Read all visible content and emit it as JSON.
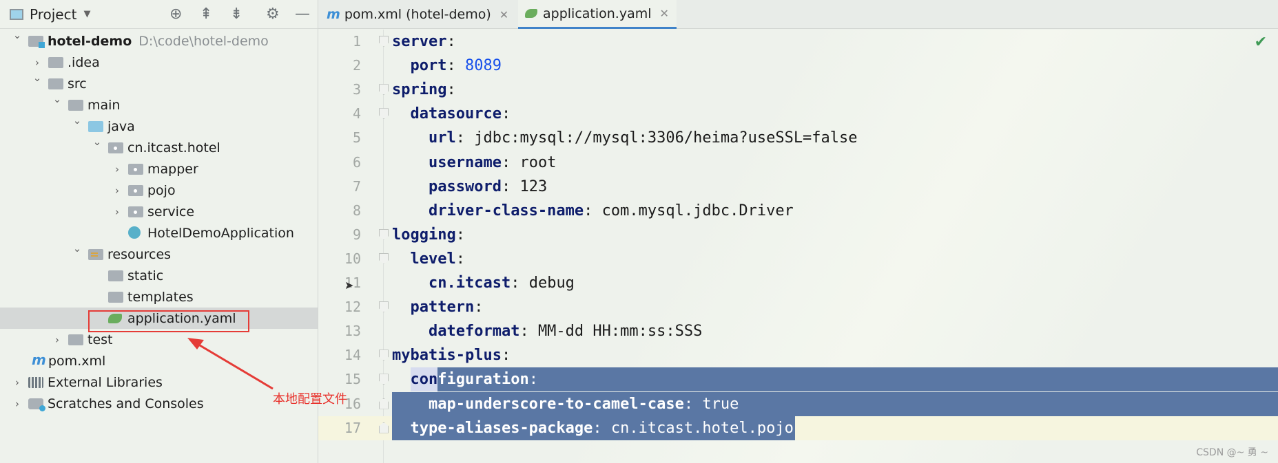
{
  "sidebar": {
    "title": "Project",
    "toolbar": [
      "locate-icon",
      "expand-all-icon",
      "collapse-all-icon",
      "gear-icon",
      "minimize-icon"
    ],
    "items": [
      {
        "label": "hotel-demo",
        "extra": "D:\\code\\hotel-demo",
        "depth": 0,
        "arrow": "open",
        "icon": "mod",
        "bold": true
      },
      {
        "label": ".idea",
        "depth": 1,
        "arrow": "closed",
        "icon": "fold"
      },
      {
        "label": "src",
        "depth": 1,
        "arrow": "open",
        "icon": "fold"
      },
      {
        "label": "main",
        "depth": 2,
        "arrow": "open",
        "icon": "fold"
      },
      {
        "label": "java",
        "depth": 3,
        "arrow": "open",
        "icon": "fold-blue"
      },
      {
        "label": "cn.itcast.hotel",
        "depth": 4,
        "arrow": "open",
        "icon": "pkg"
      },
      {
        "label": "mapper",
        "depth": 5,
        "arrow": "closed",
        "icon": "pkg"
      },
      {
        "label": "pojo",
        "depth": 5,
        "arrow": "closed",
        "icon": "pkg"
      },
      {
        "label": "service",
        "depth": 5,
        "arrow": "closed",
        "icon": "pkg"
      },
      {
        "label": "HotelDemoApplication",
        "depth": 5,
        "arrow": "none",
        "icon": "spr"
      },
      {
        "label": "resources",
        "depth": 3,
        "arrow": "open",
        "icon": "res"
      },
      {
        "label": "static",
        "depth": 4,
        "arrow": "none",
        "icon": "fold"
      },
      {
        "label": "templates",
        "depth": 4,
        "arrow": "none",
        "icon": "fold"
      },
      {
        "label": "application.yaml",
        "depth": 4,
        "arrow": "none",
        "icon": "yml",
        "selected": true
      },
      {
        "label": "test",
        "depth": 2,
        "arrow": "closed",
        "icon": "fold"
      },
      {
        "label": "pom.xml",
        "depth": 1,
        "arrow": "none",
        "icon": "mvn"
      },
      {
        "label": "External Libraries",
        "depth": 0,
        "arrow": "closed",
        "icon": "lib"
      },
      {
        "label": "Scratches and Consoles",
        "depth": 0,
        "arrow": "closed",
        "icon": "scr"
      }
    ]
  },
  "tabs": [
    {
      "label": "pom.xml (hotel-demo)",
      "icon": "maven-icon",
      "active": false
    },
    {
      "label": "application.yaml",
      "icon": "yaml-icon",
      "active": true
    }
  ],
  "editor": {
    "status": "check-icon",
    "selection_color": "#5a77a4",
    "lines": [
      {
        "n": "1",
        "indent": 0,
        "key": "server",
        "value": ""
      },
      {
        "n": "2",
        "indent": 1,
        "key": "port",
        "value": "8089",
        "type": "number"
      },
      {
        "n": "3",
        "indent": 0,
        "key": "spring",
        "value": ""
      },
      {
        "n": "4",
        "indent": 1,
        "key": "datasource",
        "value": ""
      },
      {
        "n": "5",
        "indent": 2,
        "key": "url",
        "value": "jdbc:mysql://mysql:3306/heima?useSSL=false"
      },
      {
        "n": "6",
        "indent": 2,
        "key": "username",
        "value": "root"
      },
      {
        "n": "7",
        "indent": 2,
        "key": "password",
        "value": "123"
      },
      {
        "n": "8",
        "indent": 2,
        "key": "driver-class-name",
        "value": "com.mysql.jdbc.Driver"
      },
      {
        "n": "9",
        "indent": 0,
        "key": "logging",
        "value": ""
      },
      {
        "n": "10",
        "indent": 1,
        "key": "level",
        "value": ""
      },
      {
        "n": "11",
        "indent": 2,
        "key": "cn.itcast",
        "value": "debug"
      },
      {
        "n": "12",
        "indent": 1,
        "key": "pattern",
        "value": ""
      },
      {
        "n": "13",
        "indent": 2,
        "key": "dateformat",
        "value": "MM-dd HH:mm:ss:SSS"
      },
      {
        "n": "14",
        "indent": 0,
        "key": "mybatis-plus",
        "value": ""
      },
      {
        "n": "15",
        "indent": 1,
        "key": "configuration",
        "value": "",
        "sel": "partial"
      },
      {
        "n": "16",
        "indent": 2,
        "key": "map-underscore-to-camel-case",
        "value": "true",
        "sel": "full"
      },
      {
        "n": "17",
        "indent": 1,
        "key": "type-aliases-package",
        "value": "cn.itcast.hotel.pojo",
        "sel": "text",
        "current": true
      }
    ]
  },
  "annotation": {
    "text": "本地配置文件",
    "color": "#e53c37"
  },
  "watermark": "CSDN @~ 勇 ~"
}
